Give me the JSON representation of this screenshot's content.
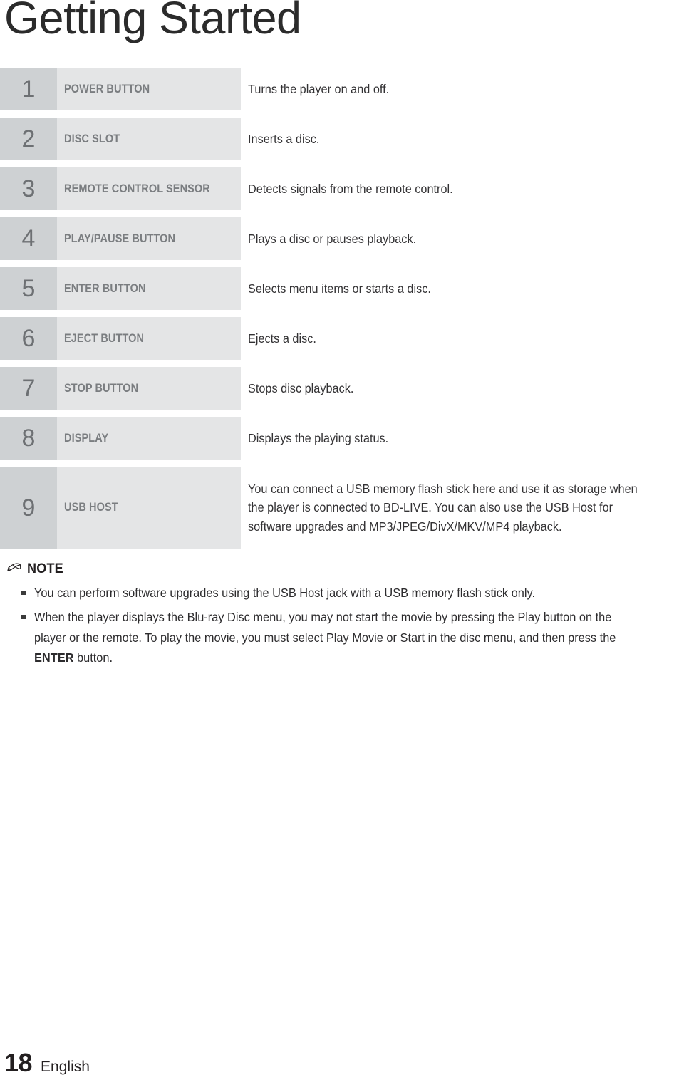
{
  "page": {
    "title": "Getting Started"
  },
  "spec_table": {
    "rows": [
      {
        "num": "1",
        "label": "POWER BUTTON",
        "desc": "Turns the player on and off."
      },
      {
        "num": "2",
        "label": "DISC SLOT",
        "desc": "Inserts a disc."
      },
      {
        "num": "3",
        "label": "REMOTE CONTROL SENSOR",
        "desc": "Detects signals from the remote control."
      },
      {
        "num": "4",
        "label": "PLAY/PAUSE BUTTON",
        "desc": "Plays a disc or pauses playback."
      },
      {
        "num": "5",
        "label": "ENTER BUTTON",
        "desc": "Selects menu items or starts a disc."
      },
      {
        "num": "6",
        "label": "EJECT BUTTON",
        "desc": "Ejects a disc."
      },
      {
        "num": "7",
        "label": "STOP BUTTON",
        "desc": "Stops disc playback."
      },
      {
        "num": "8",
        "label": "DISPLAY",
        "desc": "Displays the playing status."
      },
      {
        "num": "9",
        "label": "USB HOST",
        "desc": "You can connect a USB memory flash stick here and use it as storage when the player is connected to BD-LIVE. You can also use the USB Host for software upgrades and MP3/JPEG/DivX/MKV/MP4 playback."
      }
    ]
  },
  "note": {
    "icon": "pencil-icon",
    "heading": "NOTE",
    "items": [
      {
        "text_before": "You can perform software upgrades using the USB Host jack with a USB memory flash stick only.",
        "bold": "",
        "text_after": ""
      },
      {
        "text_before": "When the player displays the Blu-ray Disc menu, you may not start the movie by pressing the Play button on the player or the remote. To play the movie, you must select Play Movie or Start in the disc menu, and then press the ",
        "bold": "ENTER",
        "text_after": " button."
      }
    ]
  },
  "footer": {
    "page_number": "18",
    "language": "English"
  },
  "colors": {
    "number_cell_bg": "#ced1d3",
    "label_cell_bg": "#e4e5e6",
    "number_text": "#6d7073",
    "label_text": "#7a7d80",
    "body_text": "#2d2c2e",
    "title_text": "#2b2b2b"
  }
}
